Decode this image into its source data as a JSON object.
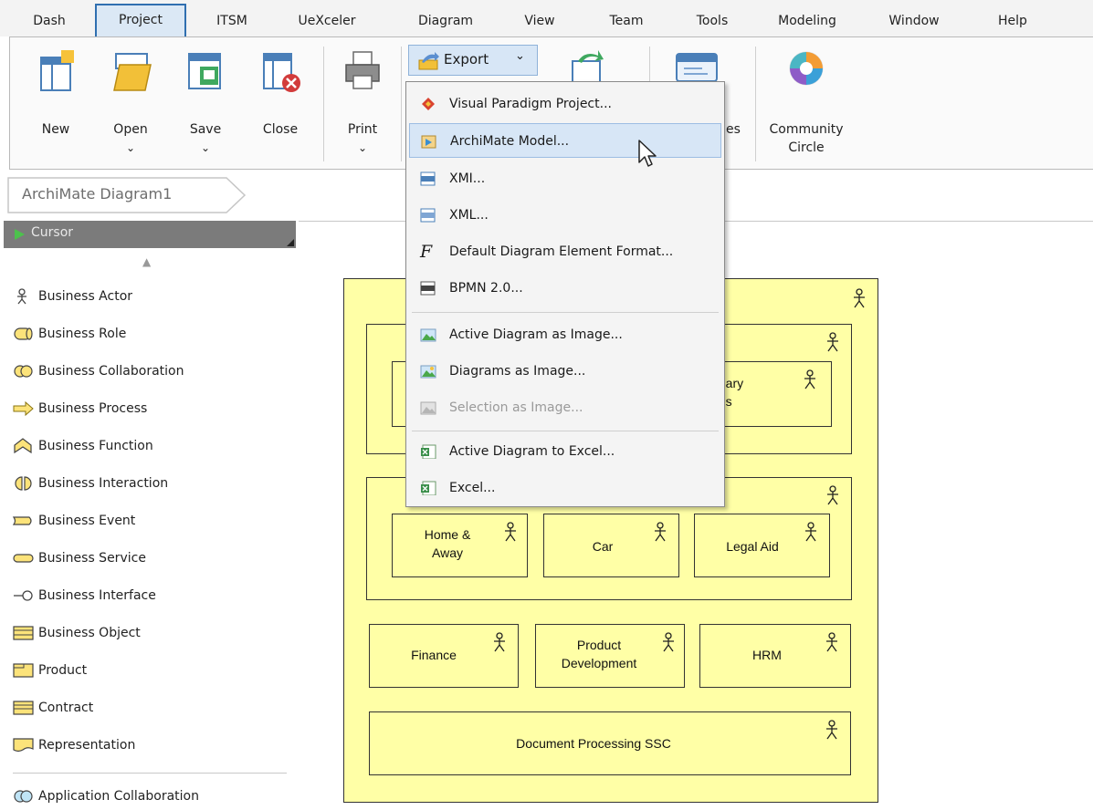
{
  "menu": {
    "tabs": [
      {
        "label": "Dash"
      },
      {
        "label": "Project"
      },
      {
        "label": "ITSM"
      },
      {
        "label": "UeXceler"
      },
      {
        "label": "Diagram"
      },
      {
        "label": "View"
      },
      {
        "label": "Team"
      },
      {
        "label": "Tools"
      },
      {
        "label": "Modeling"
      },
      {
        "label": "Window"
      },
      {
        "label": "Help"
      }
    ],
    "active_tab": "Project"
  },
  "ribbon": {
    "new": "New",
    "open": "Open",
    "save": "Save",
    "close": "Close",
    "print": "Print",
    "export": "Export",
    "partial_label": "es",
    "community_line1": "Community",
    "community_line2": "Circle",
    "chevron": "⌄"
  },
  "breadcrumb": "ArchiMate Diagram1",
  "palette": {
    "cursor": "Cursor",
    "scroll_up": "▲",
    "items": [
      {
        "label": "Business Actor"
      },
      {
        "label": "Business Role"
      },
      {
        "label": "Business Collaboration"
      },
      {
        "label": "Business Process"
      },
      {
        "label": "Business Function"
      },
      {
        "label": "Business Interaction"
      },
      {
        "label": "Business Event"
      },
      {
        "label": "Business Service"
      },
      {
        "label": "Business Interface"
      },
      {
        "label": "Business Object"
      },
      {
        "label": "Product"
      },
      {
        "label": "Contract"
      },
      {
        "label": "Representation"
      },
      {
        "label": "Application Collaboration"
      }
    ]
  },
  "export_menu": {
    "items": [
      {
        "label": "Visual Paradigm Project...",
        "icon": "vp-project-icon",
        "state": "normal"
      },
      {
        "label": "ArchiMate Model...",
        "icon": "archimate-icon",
        "state": "highlighted"
      },
      {
        "label": "XMI...",
        "icon": "xmi-icon",
        "state": "normal"
      },
      {
        "label": "XML...",
        "icon": "xml-icon",
        "state": "normal"
      },
      {
        "label": "Default Diagram Element Format...",
        "icon": "format-icon",
        "state": "normal"
      },
      {
        "label": "BPMN 2.0...",
        "icon": "bpmn-icon",
        "state": "normal"
      },
      {
        "label": "Active Diagram as Image...",
        "icon": "image-icon",
        "state": "normal"
      },
      {
        "label": "Diagrams as Image...",
        "icon": "images-icon",
        "state": "normal"
      },
      {
        "label": "Selection as Image...",
        "icon": "selection-image-icon",
        "state": "disabled"
      },
      {
        "label": "Active Diagram to Excel...",
        "icon": "excel-icon",
        "state": "normal"
      },
      {
        "label": "Excel...",
        "icon": "excel-icon",
        "state": "normal"
      }
    ]
  },
  "diagram": {
    "intermediary_1": "ediary",
    "intermediary_2": "ions",
    "home_away_1": "Home &",
    "home_away_2": "Away",
    "car": "Car",
    "legal_aid": "Legal Aid",
    "finance": "Finance",
    "product_dev_1": "Product",
    "product_dev_2": "Development",
    "hrm": "HRM",
    "doc_processing": "Document Processing SSC"
  },
  "colors": {
    "element_fill": "#ffffa6",
    "highlight": "#d7e6f6",
    "active_tab_border": "#2f6fb0"
  }
}
